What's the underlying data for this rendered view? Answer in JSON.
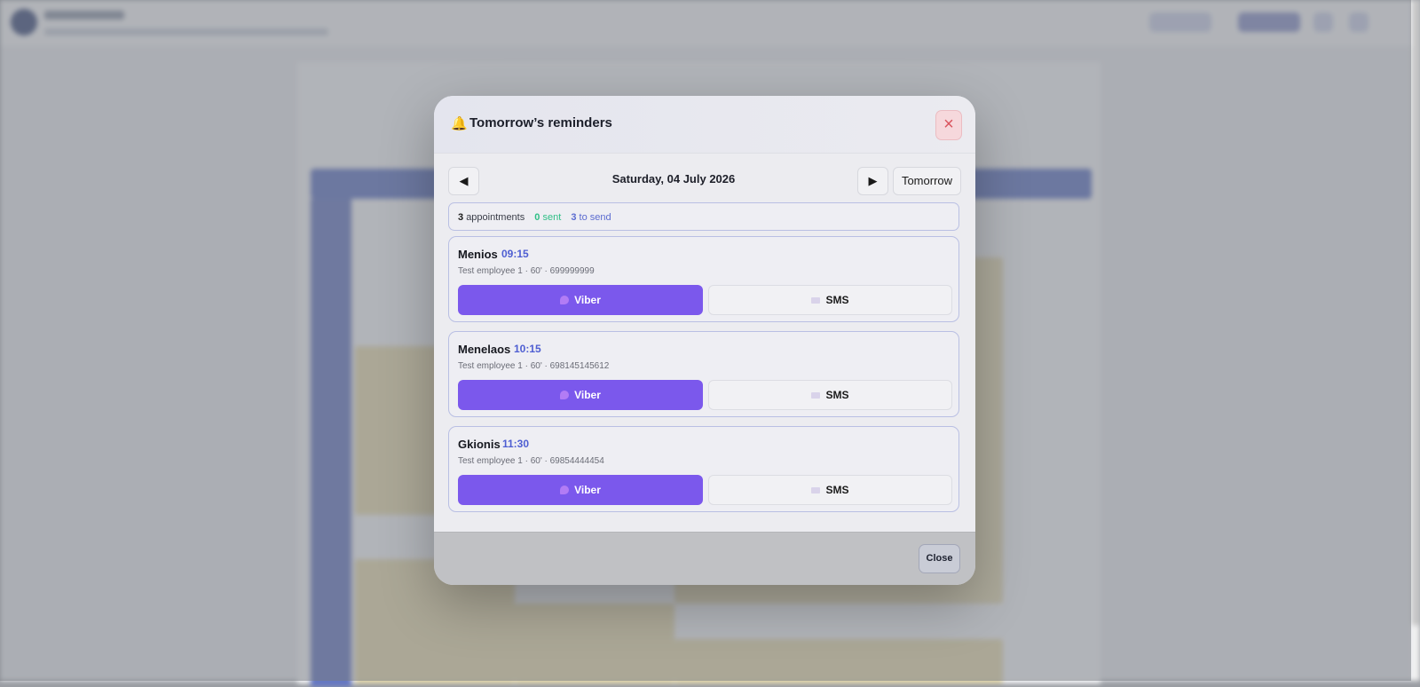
{
  "modal": {
    "title": "Tomorrow’s reminders",
    "bell_icon": "bell-icon",
    "close_icon": "close-icon",
    "nav": {
      "prev_symbol": "◀",
      "next_symbol": "▶",
      "date": "Saturday, 04 July 2026",
      "tomorrow_label": "Tomorrow"
    },
    "summary": {
      "total_count": "3",
      "total_label": "appointments",
      "sent_count": "0",
      "sent_label": "sent",
      "to_send_count": "3",
      "to_send_label": "to send"
    },
    "appointments": [
      {
        "name": "Menios",
        "time": "09:15",
        "details": "Test employee 1 · 60' · 699999999",
        "viber_label": "Viber",
        "sms_label": "SMS"
      },
      {
        "name": "Menelaos",
        "time": "10:15",
        "details": "Test employee 1 · 60' · 698145145612",
        "viber_label": "Viber",
        "sms_label": "SMS"
      },
      {
        "name": "Gkionis",
        "time": "11:30",
        "details": "Test employee 1 · 60' · 69854444454",
        "viber_label": "Viber",
        "sms_label": "SMS"
      }
    ],
    "footer": {
      "close_label": "Close"
    }
  },
  "colors": {
    "viber_purple": "#7b58ec",
    "time_blue": "#4e5ed2",
    "sent_green": "#2fbf86",
    "to_send_blue": "#5b6bd0",
    "close_red": "#d9545e"
  }
}
